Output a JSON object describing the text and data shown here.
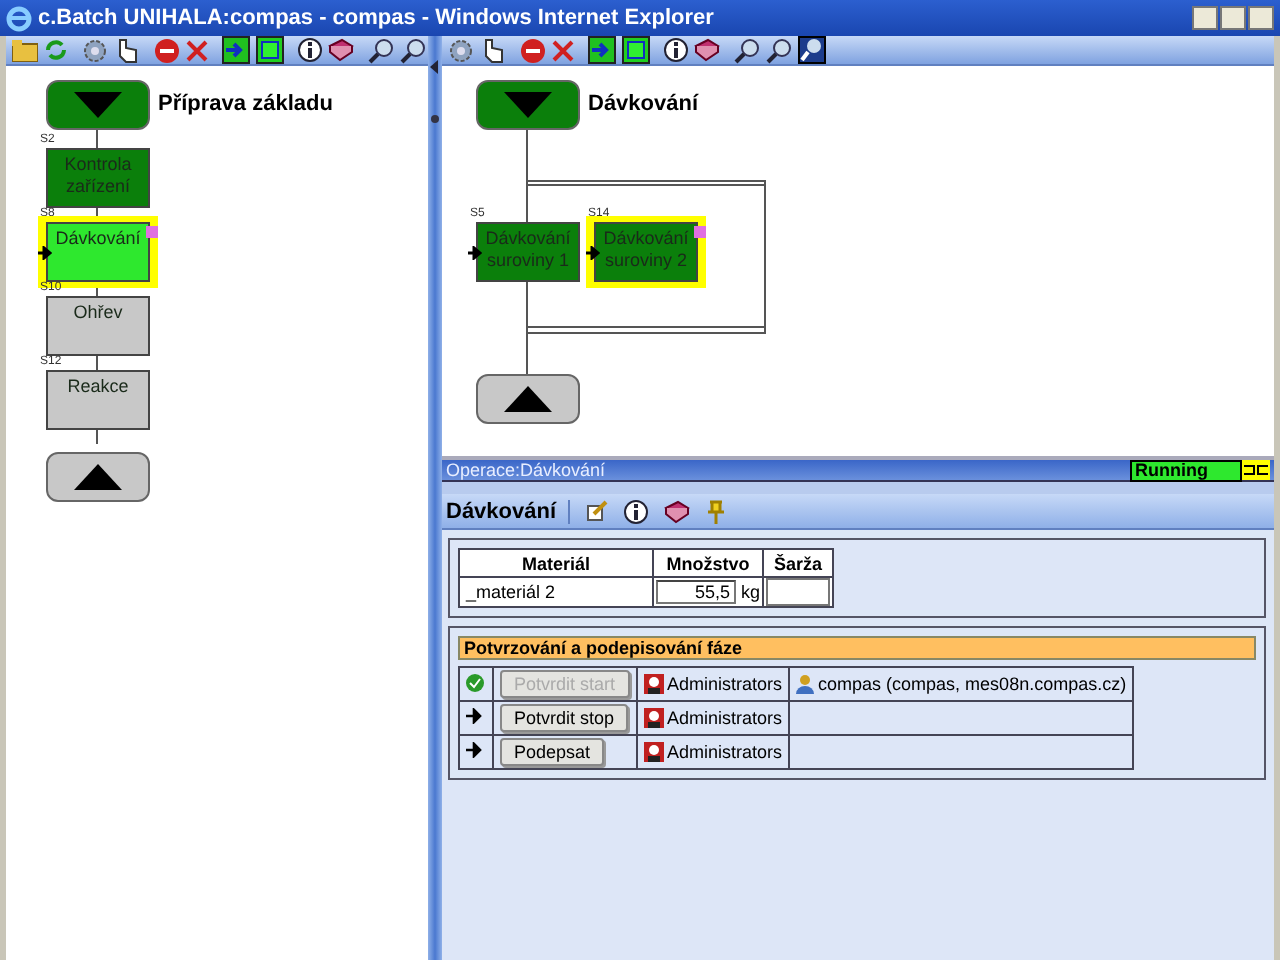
{
  "window": {
    "title": "c.Batch UNIHALA:compas - compas - Windows Internet Explorer"
  },
  "left_diagram": {
    "kind": "sequence",
    "title": "Příprava základu",
    "steps": [
      {
        "id_label": "S2",
        "label": "Kontrola zařízení",
        "kind": "completed",
        "selected": false,
        "pointer": false
      },
      {
        "id_label": "S8",
        "label": "Dávkování",
        "kind": "running",
        "selected": true,
        "pointer": true
      },
      {
        "id_label": "S10",
        "label": "Ohřev",
        "kind": "idle",
        "selected": false,
        "pointer": false
      },
      {
        "id_label": "S12",
        "label": "Reakce",
        "kind": "idle",
        "selected": false,
        "pointer": false
      }
    ]
  },
  "right_diagram": {
    "kind": "parallel",
    "title": "Dávkování",
    "steps": [
      {
        "id_label": "S5",
        "label": "Dávkování suroviny 1",
        "kind": "completed",
        "selected": false,
        "pointer": true
      },
      {
        "id_label": "S14",
        "label": "Dávkování suroviny 2",
        "kind": "completed",
        "selected": true,
        "pointer": true
      }
    ]
  },
  "operation_bar": {
    "label": "Operace:Dávkování",
    "status": "Running"
  },
  "detail": {
    "title": "Dávkování",
    "materials": {
      "columns": [
        "Materiál",
        "Množstvo",
        "Šarža"
      ],
      "rows": [
        {
          "material": "_materiál 2",
          "quantity": "55,5",
          "unit": "kg"
        }
      ]
    },
    "signoff": {
      "title": "Potvrzování a podepisování fáze",
      "rows": [
        {
          "done": true,
          "button": "Potvrdit start",
          "disabled": true,
          "group": "Administrators",
          "user": "compas (compas, mes08n.compas.cz)"
        },
        {
          "done": false,
          "button": "Potvrdit stop",
          "disabled": false,
          "group": "Administrators"
        },
        {
          "done": false,
          "button": "Podepsat",
          "disabled": false,
          "group": "Administrators"
        }
      ]
    }
  }
}
